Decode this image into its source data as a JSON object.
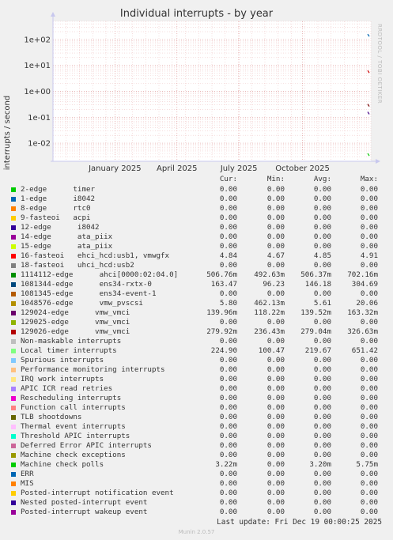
{
  "title": "Individual interrupts - by year",
  "side_label": "RRDTOOL / TOBI OETIKER",
  "chart_data": {
    "type": "line",
    "title": "Individual interrupts - by year",
    "ylabel": "interrupts / second",
    "yscale": "log",
    "ylim": [
      0.002,
      500
    ],
    "y_ticks": [
      {
        "label": "1e-02",
        "value": 0.01
      },
      {
        "label": "1e-01",
        "value": 0.1
      },
      {
        "label": "1e+00",
        "value": 1
      },
      {
        "label": "1e+01",
        "value": 10
      },
      {
        "label": "1e+02",
        "value": 100
      }
    ],
    "x_ticks": [
      "January 2025",
      "April 2025",
      "July 2025",
      "October 2025"
    ],
    "x_tick_fraction": [
      0.195,
      0.39,
      0.585,
      0.785
    ],
    "grid": true,
    "series_marks": [
      {
        "color": "#00cc00",
        "value": 0.0035
      },
      {
        "color": "#cc0000",
        "value": 5.5
      },
      {
        "color": "#0066b3",
        "value": 140
      },
      {
        "color": "#4a0a8a",
        "value": 0.14
      },
      {
        "color": "#7a0a0a",
        "value": 0.28
      }
    ]
  },
  "legend": {
    "headers": {
      "cur": "Cur:",
      "min": "Min:",
      "avg": "Avg:",
      "max": "Max:"
    },
    "rows": [
      {
        "color": "#00cc00",
        "name": "2-edge      timer",
        "cur": "0.00",
        "min": "0.00",
        "avg": "0.00",
        "max": "0.00"
      },
      {
        "color": "#0066b3",
        "name": "1-edge      i8042",
        "cur": "0.00",
        "min": "0.00",
        "avg": "0.00",
        "max": "0.00"
      },
      {
        "color": "#ff8000",
        "name": "8-edge      rtc0",
        "cur": "0.00",
        "min": "0.00",
        "avg": "0.00",
        "max": "0.00"
      },
      {
        "color": "#ffcc00",
        "name": "9-fasteoi   acpi",
        "cur": "0.00",
        "min": "0.00",
        "avg": "0.00",
        "max": "0.00"
      },
      {
        "color": "#330099",
        "name": "12-edge      i8042",
        "cur": "0.00",
        "min": "0.00",
        "avg": "0.00",
        "max": "0.00"
      },
      {
        "color": "#990099",
        "name": "14-edge      ata_piix",
        "cur": "0.00",
        "min": "0.00",
        "avg": "0.00",
        "max": "0.00"
      },
      {
        "color": "#ccff00",
        "name": "15-edge      ata_piix",
        "cur": "0.00",
        "min": "0.00",
        "avg": "0.00",
        "max": "0.00"
      },
      {
        "color": "#ff0000",
        "name": "16-fasteoi   ehci_hcd:usb1, vmwgfx",
        "cur": "4.84",
        "min": "4.67",
        "avg": "4.85",
        "max": "4.91"
      },
      {
        "color": "#808080",
        "name": "18-fasteoi   uhci_hcd:usb2",
        "cur": "0.00",
        "min": "0.00",
        "avg": "0.00",
        "max": "0.00"
      },
      {
        "color": "#008f00",
        "name": "1114112-edge      ahci[0000:02:04.0]",
        "cur": "506.76m",
        "min": "492.63m",
        "avg": "506.37m",
        "max": "702.16m"
      },
      {
        "color": "#00487d",
        "name": "1081344-edge      ens34-rxtx-0",
        "cur": "163.47",
        "min": "96.23",
        "avg": "146.18",
        "max": "304.69"
      },
      {
        "color": "#b35a00",
        "name": "1081345-edge      ens34-event-1",
        "cur": "0.00",
        "min": "0.00",
        "avg": "0.00",
        "max": "0.00"
      },
      {
        "color": "#b38f00",
        "name": "1048576-edge      vmw_pvscsi",
        "cur": "5.80",
        "min": "462.13m",
        "avg": "5.61",
        "max": "20.06"
      },
      {
        "color": "#6b006b",
        "name": "129024-edge      vmw_vmci",
        "cur": "139.96m",
        "min": "118.22m",
        "avg": "139.52m",
        "max": "163.32m"
      },
      {
        "color": "#8fb300",
        "name": "129025-edge      vmw_vmci",
        "cur": "0.00",
        "min": "0.00",
        "avg": "0.00",
        "max": "0.00"
      },
      {
        "color": "#b30000",
        "name": "129026-edge      vmw_vmci",
        "cur": "279.92m",
        "min": "236.43m",
        "avg": "279.04m",
        "max": "326.63m"
      },
      {
        "color": "#bebebe",
        "name": "Non-maskable interrupts",
        "cur": "0.00",
        "min": "0.00",
        "avg": "0.00",
        "max": "0.00"
      },
      {
        "color": "#80ff80",
        "name": "Local timer interrupts",
        "cur": "224.90",
        "min": "100.47",
        "avg": "219.67",
        "max": "651.42"
      },
      {
        "color": "#80c9ff",
        "name": "Spurious interrupts",
        "cur": "0.00",
        "min": "0.00",
        "avg": "0.00",
        "max": "0.00"
      },
      {
        "color": "#ffc080",
        "name": "Performance monitoring interrupts",
        "cur": "0.00",
        "min": "0.00",
        "avg": "0.00",
        "max": "0.00"
      },
      {
        "color": "#ffe680",
        "name": "IRQ work interrupts",
        "cur": "0.00",
        "min": "0.00",
        "avg": "0.00",
        "max": "0.00"
      },
      {
        "color": "#aa80ff",
        "name": "APIC ICR read retries",
        "cur": "0.00",
        "min": "0.00",
        "avg": "0.00",
        "max": "0.00"
      },
      {
        "color": "#ee00cc",
        "name": "Rescheduling interrupts",
        "cur": "0.00",
        "min": "0.00",
        "avg": "0.00",
        "max": "0.00"
      },
      {
        "color": "#ff8080",
        "name": "Function call interrupts",
        "cur": "0.00",
        "min": "0.00",
        "avg": "0.00",
        "max": "0.00"
      },
      {
        "color": "#666600",
        "name": "TLB shootdowns",
        "cur": "0.00",
        "min": "0.00",
        "avg": "0.00",
        "max": "0.00"
      },
      {
        "color": "#ffbfff",
        "name": "Thermal event interrupts",
        "cur": "0.00",
        "min": "0.00",
        "avg": "0.00",
        "max": "0.00"
      },
      {
        "color": "#00ffcc",
        "name": "Threshold APIC interrupts",
        "cur": "0.00",
        "min": "0.00",
        "avg": "0.00",
        "max": "0.00"
      },
      {
        "color": "#cc6699",
        "name": "Deferred Error APIC interrupts",
        "cur": "0.00",
        "min": "0.00",
        "avg": "0.00",
        "max": "0.00"
      },
      {
        "color": "#999900",
        "name": "Machine check exceptions",
        "cur": "0.00",
        "min": "0.00",
        "avg": "0.00",
        "max": "0.00"
      },
      {
        "color": "#00cc00",
        "name": "Machine check polls",
        "cur": "3.22m",
        "min": "0.00",
        "avg": "3.20m",
        "max": "5.75m"
      },
      {
        "color": "#0066b3",
        "name": "ERR",
        "cur": "0.00",
        "min": "0.00",
        "avg": "0.00",
        "max": "0.00"
      },
      {
        "color": "#ff8000",
        "name": "MIS",
        "cur": "0.00",
        "min": "0.00",
        "avg": "0.00",
        "max": "0.00"
      },
      {
        "color": "#ffcc00",
        "name": "Posted-interrupt notification event",
        "cur": "0.00",
        "min": "0.00",
        "avg": "0.00",
        "max": "0.00"
      },
      {
        "color": "#330099",
        "name": "Nested posted-interrupt event",
        "cur": "0.00",
        "min": "0.00",
        "avg": "0.00",
        "max": "0.00"
      },
      {
        "color": "#990099",
        "name": "Posted-interrupt wakeup event",
        "cur": "0.00",
        "min": "0.00",
        "avg": "0.00",
        "max": "0.00"
      }
    ]
  },
  "footer": {
    "last_update": "Last update: Fri Dec 19 00:00:25 2025",
    "version": "Munin 2.0.57"
  }
}
